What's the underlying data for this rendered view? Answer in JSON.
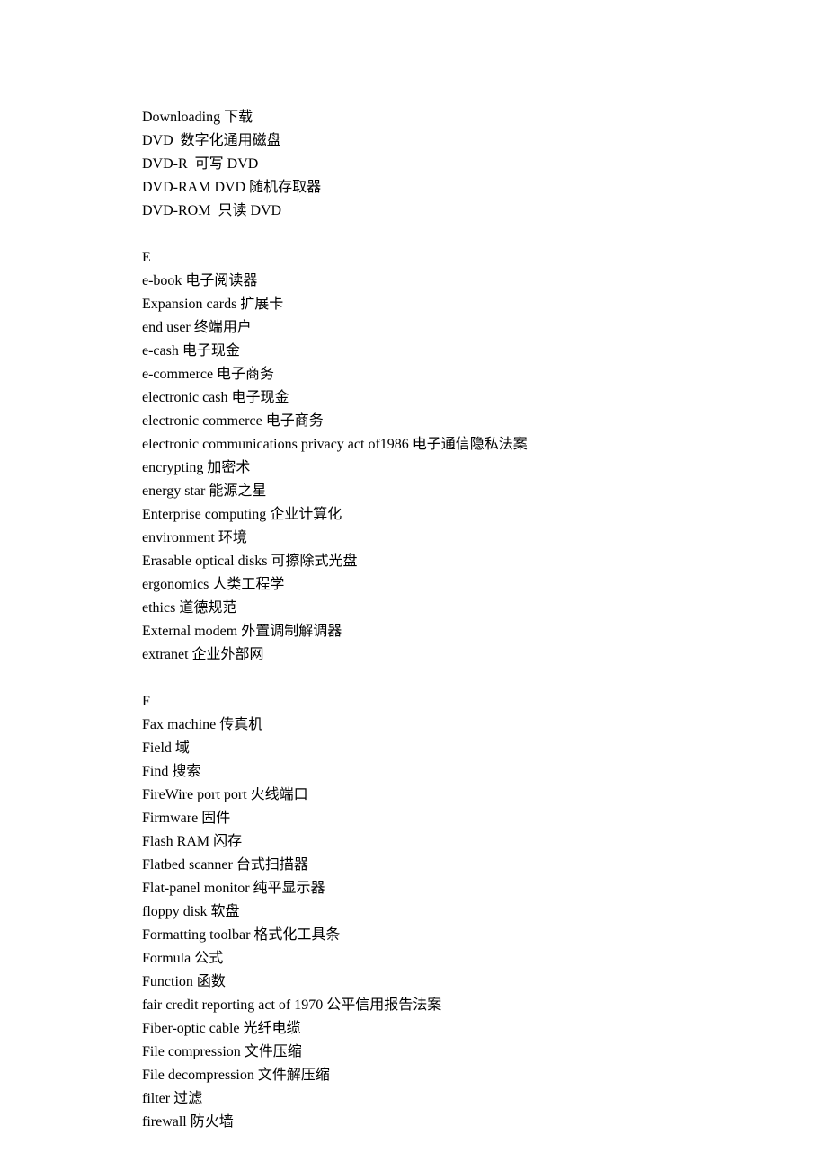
{
  "sections": [
    {
      "header": null,
      "items": [
        "Downloading 下载",
        "DVD  数字化通用磁盘",
        "DVD-R  可写 DVD",
        "DVD-RAM DVD 随机存取器",
        "DVD-ROM  只读 DVD"
      ]
    },
    {
      "header": "E",
      "items": [
        "e-book 电子阅读器",
        "Expansion cards 扩展卡",
        "end user 终端用户",
        "e-cash 电子现金",
        "e-commerce 电子商务",
        "electronic cash 电子现金",
        "electronic commerce 电子商务",
        "electronic communications privacy act of1986 电子通信隐私法案",
        "encrypting 加密术",
        "energy star 能源之星",
        "Enterprise computing 企业计算化",
        "environment 环境",
        "Erasable optical disks 可擦除式光盘",
        "ergonomics 人类工程学",
        "ethics 道德规范",
        "External modem 外置调制解调器",
        "extranet 企业外部网"
      ]
    },
    {
      "header": "F",
      "items": [
        "Fax machine 传真机",
        "Field 域",
        "Find 搜索",
        "FireWire port port 火线端口",
        "Firmware 固件",
        "Flash RAM 闪存",
        "Flatbed scanner 台式扫描器",
        "Flat-panel monitor 纯平显示器",
        "floppy disk 软盘",
        "Formatting toolbar 格式化工具条",
        "Formula 公式",
        "Function 函数",
        "fair credit reporting act of 1970 公平信用报告法案",
        "Fiber-optic cable 光纤电缆",
        "File compression 文件压缩",
        "File decompression 文件解压缩",
        "filter 过滤",
        "firewall 防火墙"
      ]
    }
  ]
}
